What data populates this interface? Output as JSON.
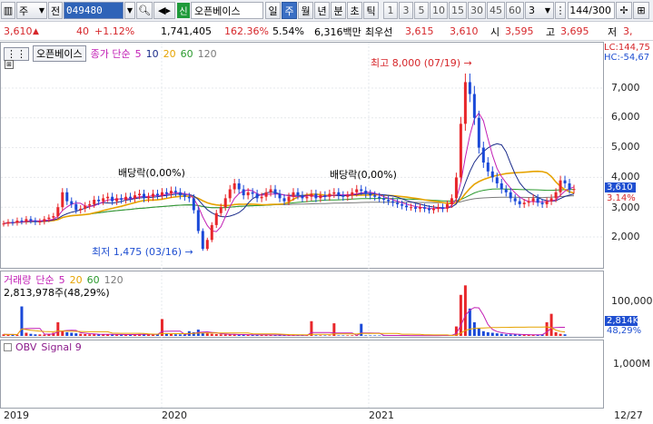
{
  "toolbar": {
    "market": "주",
    "prev_label": "전",
    "code": "049480",
    "sin_label": "신",
    "stock_name": "오픈베이스",
    "periods": [
      "일",
      "주",
      "월",
      "년",
      "분",
      "초",
      "틱"
    ],
    "selected_period": "주",
    "intervals": [
      "1",
      "3",
      "5",
      "10",
      "15",
      "30",
      "45",
      "60"
    ],
    "interval_value": "3",
    "count": "144/300"
  },
  "quote": {
    "price": "3,610",
    "arrow": "▲",
    "change": "40",
    "change_pct": "+1.12%",
    "volume": "1,741,405",
    "volume_ratio": "162.36%",
    "turnover": "5.54%",
    "amount": "6,316백만",
    "best_label": "최우선",
    "ask": "3,615",
    "bid": "3,610",
    "open_label": "시",
    "open": "3,595",
    "high_label": "고",
    "high": "3,695",
    "low_label": "저",
    "low": "3,"
  },
  "price_panel": {
    "title": "오픈베이스",
    "ma_label": "종가 단순",
    "ma_periods": [
      "5",
      "10",
      "20",
      "60",
      "120"
    ],
    "lc": "LC:144,75",
    "hc": "HC:-54,67",
    "y_labels": [
      "7,000",
      "6,000",
      "5,000",
      "4,000",
      "3,000",
      "2,000"
    ],
    "current_tag": "3,610",
    "pct_tag": "3.14%",
    "high_note": "최고 8,000 (07/19)",
    "low_note": "최저 1,475 (03/16)",
    "dividend_1": "배당락(0,00%)",
    "dividend_2": "배당락(0,00%)"
  },
  "volume_panel": {
    "title": "거래량",
    "ma_label": "단순",
    "ma_periods": [
      "5",
      "20",
      "60",
      "120"
    ],
    "info": "2,813,978주(48,29%)",
    "y_label": "100,000K",
    "current_tag": "2,814K",
    "pct_tag": "48,29%"
  },
  "obv_panel": {
    "title": "OBV",
    "signal": "Signal 9",
    "y_label": "1,000M"
  },
  "x_axis": [
    "2019",
    "2020",
    "2021",
    "12/27"
  ],
  "colors": {
    "up": "#e8262a",
    "down": "#1a49d8",
    "ma5": "#c21fb5",
    "ma10": "#1a2b8a",
    "ma20": "#e6a300",
    "ma60": "#2b9a2e",
    "ma120": "#7a7a7a",
    "obv": "#8b1a8b",
    "signal": "#e67e00",
    "tag_blue": "#1f4fd1",
    "tag_red": "#d6262a"
  },
  "chart_data": {
    "type": "candlestick",
    "x_range": [
      "2019",
      "12/27"
    ],
    "ylim": [
      1300,
      8100
    ],
    "price_close": [
      2450,
      2500,
      2480,
      2550,
      2520,
      2600,
      2550,
      2500,
      2520,
      2600,
      2650,
      2700,
      3000,
      3500,
      3200,
      3100,
      2900,
      2950,
      3050,
      3100,
      3250,
      3200,
      3300,
      3350,
      3200,
      3300,
      3250,
      3350,
      3300,
      3400,
      3450,
      3300,
      3350,
      3450,
      3400,
      3500,
      3450,
      3550,
      3500,
      3400,
      3350,
      3300,
      2900,
      2200,
      1600,
      1900,
      2400,
      2800,
      3000,
      3300,
      3600,
      3800,
      3600,
      3400,
      3500,
      3450,
      3300,
      3350,
      3500,
      3600,
      3450,
      3300,
      3200,
      3350,
      3500,
      3400,
      3300,
      3350,
      3450,
      3300,
      3400,
      3350,
      3450,
      3500,
      3400,
      3350,
      3400,
      3500,
      3600,
      3550,
      3450,
      3400,
      3350,
      3300,
      3250,
      3200,
      3150,
      3100,
      3050,
      3000,
      3000,
      2950,
      3000,
      2950,
      2900,
      2950,
      3000,
      2950,
      3100,
      3300,
      4000,
      5800,
      7200,
      6800,
      6000,
      5000,
      4500,
      4200,
      4000,
      3800,
      3600,
      3500,
      3300,
      3200,
      3100,
      3150,
      3200,
      3300,
      3150,
      3100,
      3200,
      3300,
      3500,
      3900,
      3800,
      3600,
      3610
    ],
    "volume": [
      300,
      250,
      260,
      220,
      5600,
      600,
      400,
      300,
      280,
      250,
      400,
      600,
      2600,
      900,
      700,
      600,
      500,
      400,
      350,
      300,
      320,
      300,
      280,
      260,
      300,
      280,
      250,
      240,
      260,
      300,
      350,
      300,
      280,
      250,
      260,
      3200,
      400,
      350,
      300,
      280,
      260,
      900,
      700,
      1200,
      600,
      500,
      400,
      350,
      300,
      280,
      260,
      250,
      240,
      230,
      220,
      210,
      200,
      190,
      180,
      170,
      160,
      150,
      140,
      130,
      120,
      110,
      100,
      100,
      2800,
      120,
      110,
      100,
      100,
      2400,
      100,
      100,
      110,
      120,
      100,
      2300,
      110,
      100,
      100,
      90,
      80,
      90,
      80,
      70,
      80,
      70,
      80,
      70,
      80,
      70,
      80,
      70,
      80,
      90,
      100,
      200,
      1800,
      7800,
      9600,
      5200,
      2600,
      1400,
      900,
      700,
      600,
      500,
      400,
      300,
      280,
      260,
      240,
      220,
      200,
      240,
      260,
      300,
      2600,
      4200,
      700,
      400,
      300
    ]
  }
}
